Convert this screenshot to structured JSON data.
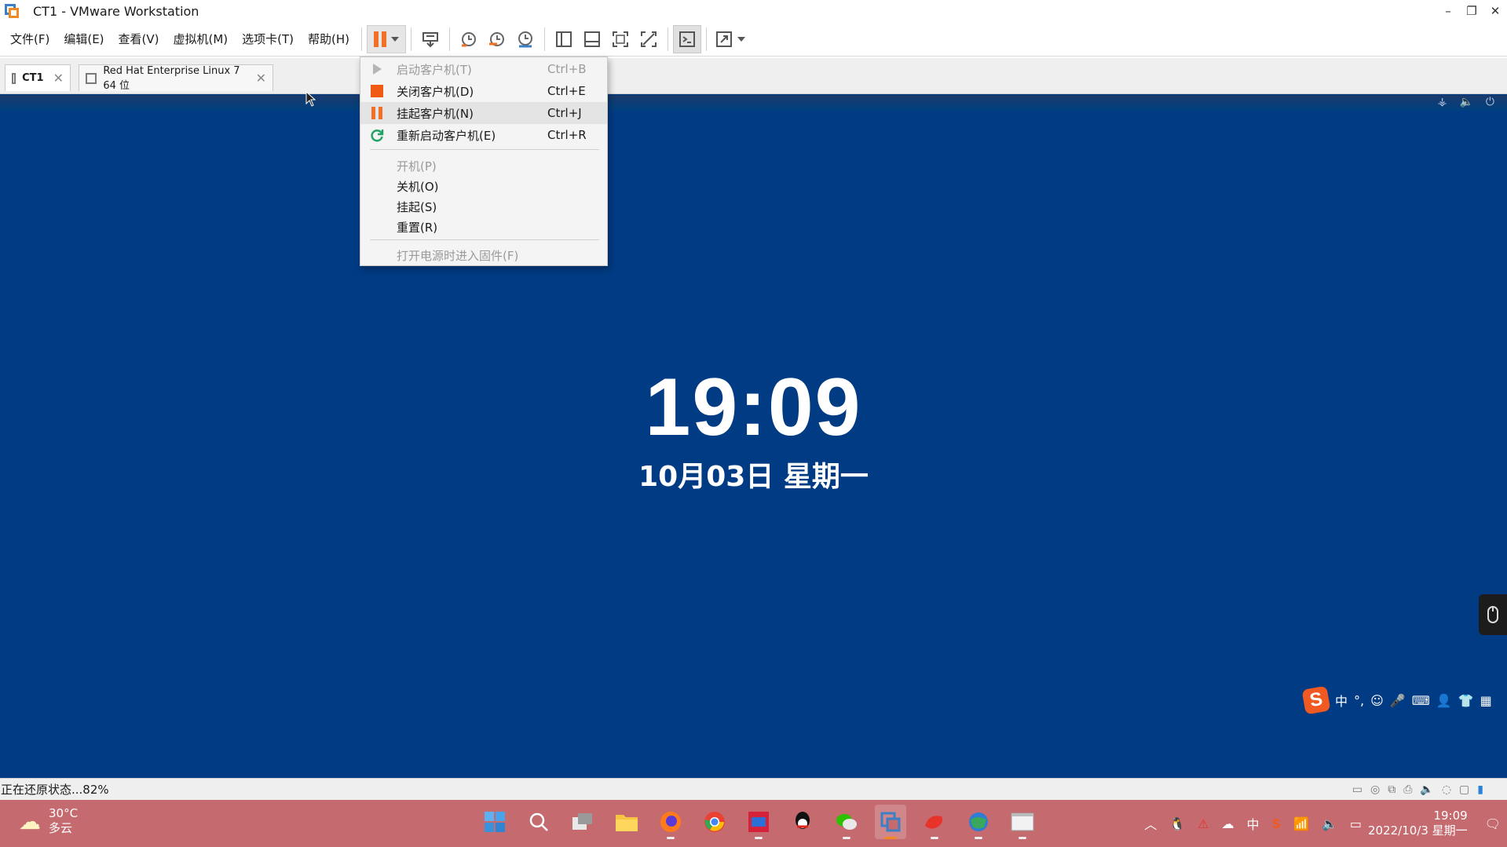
{
  "window": {
    "title": "CT1 - VMware Workstation",
    "controls": {
      "minimize": "–",
      "restore": "❐",
      "close": "✕"
    }
  },
  "menu": {
    "items": [
      "文件(F)",
      "编辑(E)",
      "查看(V)",
      "虚拟机(M)",
      "选项卡(T)",
      "帮助(H)"
    ]
  },
  "toolbar": {
    "buttons": [
      "pause-icon",
      "send-ctrl-alt-del-icon",
      "snapshot-icon",
      "revert-snapshot-icon",
      "snapshot-manager-icon",
      "library-icon",
      "thumbnail-bar-icon",
      "full-screen-icon",
      "unity-icon",
      "console-icon",
      "stretch-icon"
    ]
  },
  "tabs": [
    {
      "label": "CT1",
      "close": "✕"
    },
    {
      "label": "Red Hat Enterprise Linux 7 64 位",
      "close": "✕"
    }
  ],
  "dropdown": {
    "items": [
      {
        "label": "启动客户机(T)",
        "shortcut": "Ctrl+B",
        "disabled": true,
        "icon": "play-icon"
      },
      {
        "label": "关闭客户机(D)",
        "shortcut": "Ctrl+E",
        "disabled": false,
        "icon": "stop-icon"
      },
      {
        "label": "挂起客户机(N)",
        "shortcut": "Ctrl+J",
        "disabled": false,
        "icon": "pause-icon"
      },
      {
        "label": "重新启动客户机(E)",
        "shortcut": "Ctrl+R",
        "disabled": false,
        "icon": "restart-icon"
      },
      {
        "label": "开机(P)",
        "disabled": true
      },
      {
        "label": "关机(O)",
        "disabled": false
      },
      {
        "label": "挂起(S)",
        "disabled": false
      },
      {
        "label": "重置(R)",
        "disabled": false
      },
      {
        "label": "打开电源时进入固件(F)",
        "disabled": true
      }
    ]
  },
  "vm": {
    "time": "19:09",
    "date": "10月03日 星期一",
    "background_color": "#003b84"
  },
  "ime": {
    "logo": "S",
    "items": [
      "中",
      "°,",
      "☺",
      "🎤",
      "⌨",
      "👤",
      "👕",
      "▦"
    ]
  },
  "statusbar": {
    "text": "正在还原状态...82%"
  },
  "taskbar": {
    "weather_temp": "30°C",
    "weather_desc": "多云",
    "apps": [
      "start-icon",
      "search-icon",
      "task-view-icon",
      "file-explorer-icon",
      "firefox-icon",
      "chrome-icon",
      "app-icon",
      "qq-icon",
      "wechat-icon",
      "vmware-icon",
      "app-red-icon",
      "app-globe-icon",
      "app-window-icon"
    ],
    "tray_ime": "中",
    "tray_time": "19:09",
    "tray_date": "2022/10/3 星期一"
  }
}
